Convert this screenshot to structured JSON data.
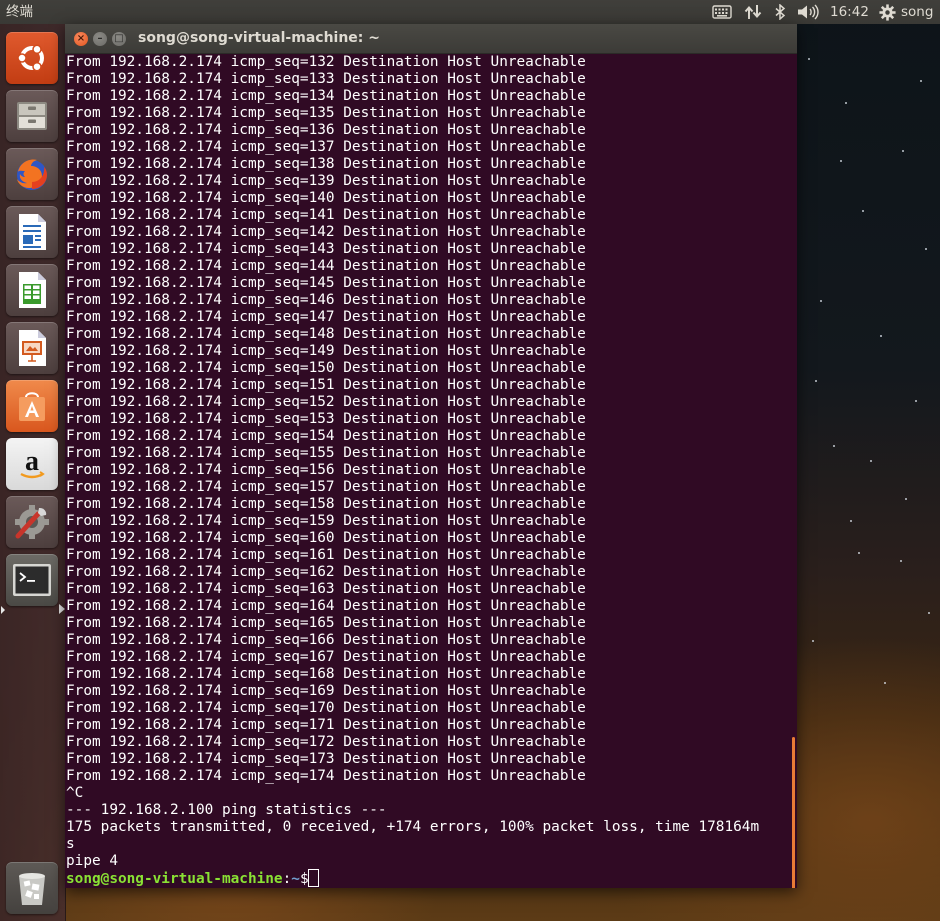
{
  "top_panel": {
    "app_name": "终端",
    "clock": "16:42",
    "user": "song",
    "icons": [
      "keyboard-icon",
      "network-arrows-icon",
      "bluetooth-icon",
      "volume-icon",
      "gear-icon"
    ]
  },
  "launcher": {
    "items": [
      {
        "name": "ubuntu-dash-icon"
      },
      {
        "name": "files-icon"
      },
      {
        "name": "firefox-icon"
      },
      {
        "name": "libreoffice-writer-icon"
      },
      {
        "name": "libreoffice-calc-icon"
      },
      {
        "name": "libreoffice-impress-icon"
      },
      {
        "name": "software-center-icon"
      },
      {
        "name": "amazon-icon"
      },
      {
        "name": "system-settings-icon"
      },
      {
        "name": "terminal-icon"
      },
      {
        "name": "trash-icon"
      }
    ],
    "active_item": "terminal-icon"
  },
  "window": {
    "title": "song@song-virtual-machine: ~"
  },
  "terminal": {
    "source_ip": "192.168.2.174",
    "message": "Destination Host Unreachable",
    "seq_start": 132,
    "seq_end": 174,
    "interrupt": "^C",
    "stats_header": "--- 192.168.2.100 ping statistics ---",
    "stats_line_1": "175 packets transmitted, 0 received, +174 errors, 100% packet loss, time 178164m",
    "stats_line_2": "s",
    "extra_line": "pipe 4",
    "prompt_user_host": "song@song-virtual-machine",
    "prompt_sep": ":",
    "prompt_path": "~",
    "prompt_symbol": "$"
  },
  "colors": {
    "terminal_bg": "#300a24",
    "terminal_fg": "#ffffff",
    "prompt_user": "#8ae234",
    "prompt_path": "#729fcf",
    "scrollbar": "#e97b36",
    "close_button": "#e2541d"
  }
}
